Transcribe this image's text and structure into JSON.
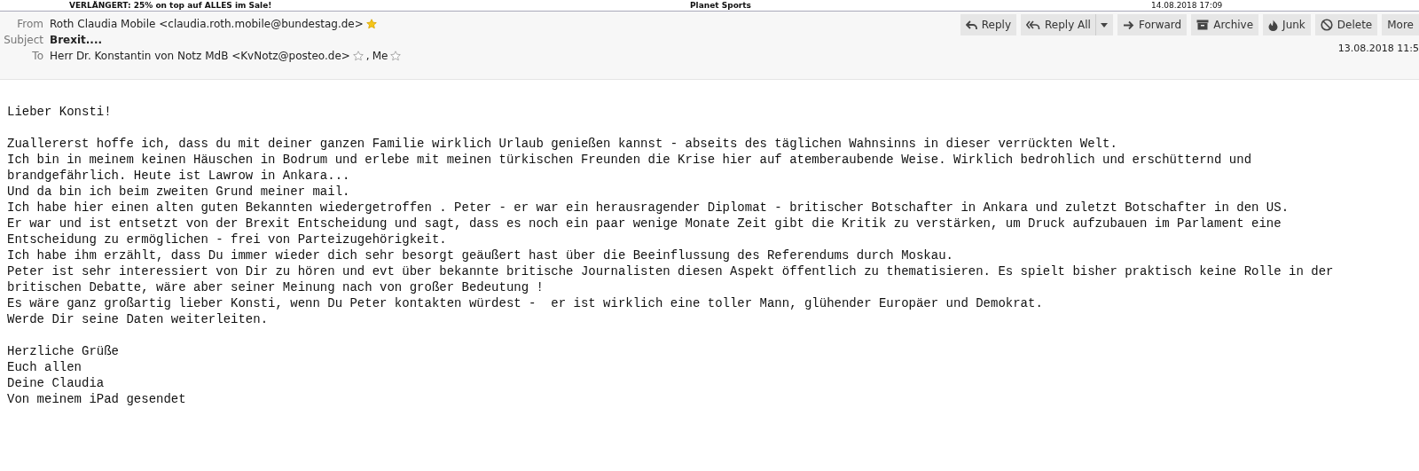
{
  "message_list_row": {
    "subject": "VERLÄNGERT: 25% on top auf ALLES im Sale!",
    "sender": "Planet Sports",
    "date": "14.08.2018 17:09"
  },
  "header": {
    "from": {
      "label": "From",
      "value": "Roth Claudia Mobile <claudia.roth.mobile@bundestag.de>",
      "starred": true
    },
    "subject": {
      "label": "Subject",
      "value": "Brexit...."
    },
    "to": {
      "label": "To",
      "recipients": [
        {
          "value": "Herr Dr. Konstantin von Notz MdB <KvNotz@posteo.de>",
          "starred": false,
          "separator": ","
        },
        {
          "value": "Me",
          "starred": false
        }
      ]
    },
    "date": "13.08.2018 11:5",
    "buttons": [
      {
        "kind": "reply",
        "label": "Reply",
        "dropdown": false
      },
      {
        "kind": "reply-all",
        "label": "Reply All",
        "dropdown": true
      },
      {
        "kind": "forward",
        "label": "Forward",
        "dropdown": false
      },
      {
        "kind": "archive",
        "label": "Archive",
        "dropdown": false
      },
      {
        "kind": "junk",
        "label": "Junk",
        "dropdown": false
      },
      {
        "kind": "delete",
        "label": "Delete",
        "dropdown": false
      },
      {
        "kind": "more",
        "label": "More",
        "dropdown": false
      }
    ]
  },
  "body": [
    [
      "Lieber Konsti!"
    ],
    [
      "Zuallererst hoffe ich, dass du mit deiner ganzen Familie wirklich Urlaub genießen kannst - abseits des täglichen Wahnsinns in dieser verrückten Welt.",
      "Ich bin in meinem keinen Häuschen in Bodrum und erlebe mit meinen türkischen Freunden die Krise hier auf atemberaubende Weise. Wirklich bedrohlich und erschütternd und",
      "brandgefährlich. Heute ist Lawrow in Ankara...",
      "Und da bin ich beim zweiten Grund meiner mail.",
      "Ich habe hier einen alten guten Bekannten wiedergetroffen . Peter - er war ein herausragender Diplomat - britischer Botschafter in Ankara und zuletzt Botschafter in den US.",
      "Er war und ist entsetzt von der Brexit Entscheidung und sagt, dass es noch ein paar wenige Monate Zeit gibt die Kritik zu verstärken, um Druck aufzubauen im Parlament eine",
      "Entscheidung zu ermöglichen - frei von Parteizugehörigkeit.",
      "Ich habe ihm erzählt, dass Du immer wieder dich sehr besorgt geäußert hast über die Beeinflussung des Referendums durch Moskau.",
      "Peter ist sehr interessiert von Dir zu hören und evt über bekannte britische Journalisten diesen Aspekt öffentlich zu thematisieren. Es spielt bisher praktisch keine Rolle in der",
      "britischen Debatte, wäre aber seiner Meinung nach von großer Bedeutung !",
      "Es wäre ganz großartig lieber Konsti, wenn Du Peter kontakten würdest -  er ist wirklich eine toller Mann, glühender Europäer und Demokrat.",
      "Werde Dir seine Daten weiterleiten."
    ],
    [
      "Herzliche Grüße",
      "Euch allen",
      "Deine Claudia",
      "Von meinem iPad gesendet"
    ]
  ]
}
